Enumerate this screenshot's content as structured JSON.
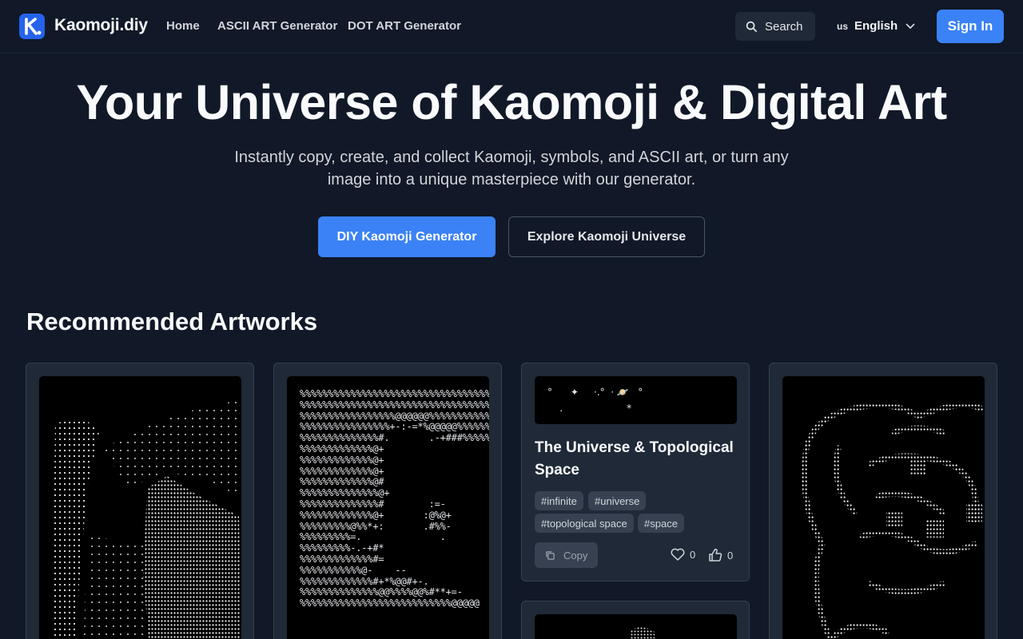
{
  "header": {
    "brand": "Kaomoji.diy",
    "logo_letter": "K.",
    "nav": [
      {
        "label": "Home"
      },
      {
        "label": "ASCII ART Generator"
      },
      {
        "label": "DOT ART Generator"
      }
    ],
    "search_label": "Search",
    "language": {
      "flag": "us",
      "label": "English"
    },
    "signin_label": "Sign In"
  },
  "hero": {
    "title": "Your Universe of Kaomoji & Digital Art",
    "subtitle": "Instantly copy, create, and collect Kaomoji, symbols, and ASCII art, or turn any image into a unique masterpiece with our generator.",
    "primary_cta": "DIY Kaomoji Generator",
    "secondary_cta": "Explore Kaomoji Universe"
  },
  "recommended": {
    "title": "Recommended Artworks",
    "featured": {
      "art_preview": "°      ✦     ·.°  · 🪐   °\n    .                     *",
      "title": "The Universe & Topological Space",
      "tags": [
        "#infinite",
        "#universe",
        "#topological space",
        "#space"
      ],
      "copy_label": "Copy",
      "likes": "0",
      "thumbs": "0"
    },
    "ascii_card2": "%%%%%%%%%%%%%%%%%%%%%%%%%%%%%%%%%%%%\n%%%%%%%%%%%%%%%%%%%%%%%%%%%%%%%%%%%%\n%%%%%%%%%%%%%%%%%@@@@@@%%%%%%%%%%%%%\n%%%%%%%%%%%%%%%%+-:-=*%@@@@@%%%%%%%%\n%%%%%%%%%%%%%%#.       .-+###%%%%%%%\n%%%%%%%%%%%%%@+\n%%%%%%%%%%%%%@+\n%%%%%%%%%%%%%@+\n%%%%%%%%%%%%%@#\n%%%%%%%%%%%%%%@+\n%%%%%%%%%%%%%%#        :=-\n%%%%%%%%%%%%%@+       :@%@+\n%%%%%%%%%@%%*+:       .#%%-\n%%%%%%%%%=.              .\n%%%%%%%%%-.-+#*\n%%%%%%%%%%%%%#=\n%%%%%%%%%%%@-    --\n%%%%%%%%%%%%%#+*%@@#+-.\n%%%%%%%%%%%%%%@@%%%%@@%#**+=-\n%%%%%%%%%%%%%%%%%%%%%%%%%%%@@@@@"
  }
}
